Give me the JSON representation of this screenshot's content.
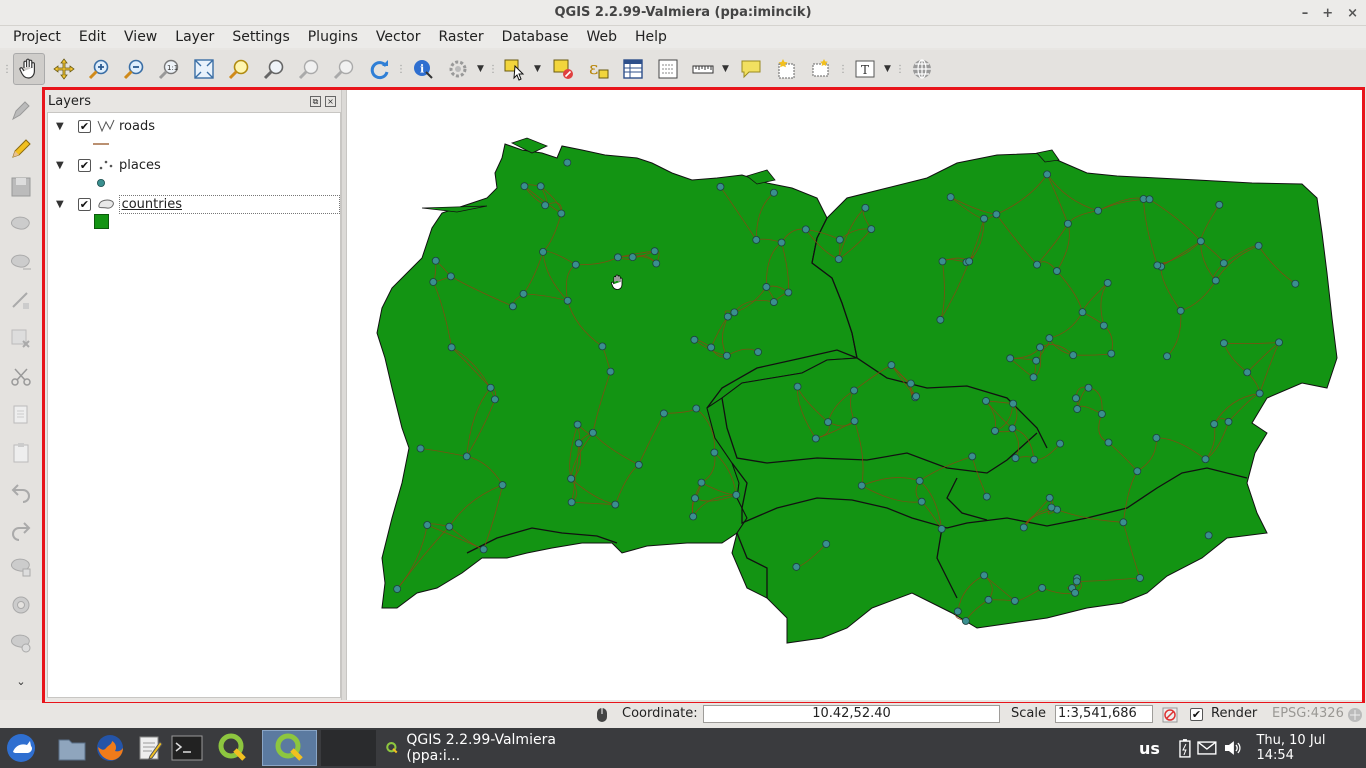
{
  "window": {
    "title": "QGIS 2.2.99-Valmiera (ppa:imincik)",
    "min": "–",
    "max": "+",
    "close": "×"
  },
  "menu": [
    "Project",
    "Edit",
    "View",
    "Layer",
    "Settings",
    "Plugins",
    "Vector",
    "Raster",
    "Database",
    "Web",
    "Help"
  ],
  "layers_panel": {
    "title": "Layers",
    "layers": [
      {
        "name": "roads",
        "checked": true,
        "expanded": true
      },
      {
        "name": "places",
        "checked": true,
        "expanded": true
      },
      {
        "name": "countries",
        "checked": true,
        "expanded": true,
        "selected": true
      }
    ]
  },
  "map": {
    "fill_color": "#139413",
    "road_color": "#8b4513",
    "place_color": "#3a8f8f",
    "cursor": "pan-hand"
  },
  "status": {
    "coordinate_label": "Coordinate:",
    "coordinate_value": "10.42,52.40",
    "scale_label": "Scale",
    "scale_value": "1:3,541,686",
    "render_label": "Render",
    "render_checked": true,
    "crs": "EPSG:4326"
  },
  "taskbar": {
    "task_title": "QGIS 2.2.99-Valmiera (ppa:i...",
    "keyboard": "us",
    "clock": "Thu, 10 Jul  14:54"
  }
}
